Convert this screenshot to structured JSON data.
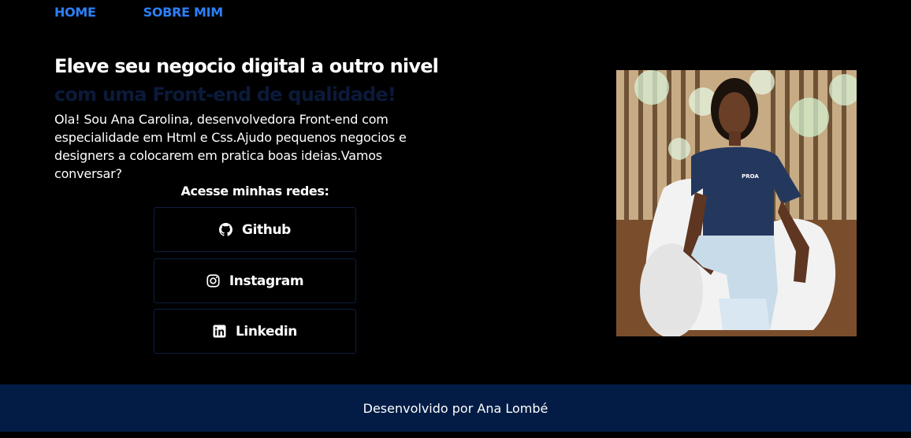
{
  "nav": {
    "home_label": "HOME",
    "about_label": "SOBRE MIM"
  },
  "hero": {
    "title": "Eleve seu negocio digital a outro nivel",
    "subtitle": "com uma Front-end de qualidade!",
    "intro": "Ola! Sou Ana Carolina, desenvolvedora Front-end com especialidade em Html e Css.Ajudo pequenos negocios e designers a colocarem em pratica boas ideias.Vamos conversar?"
  },
  "socials": {
    "heading": "Acesse minhas redes:",
    "items": [
      {
        "label": "Github",
        "icon": "github-icon"
      },
      {
        "label": "Instagram",
        "icon": "instagram-icon"
      },
      {
        "label": "Linkedin",
        "icon": "linkedin-icon"
      }
    ]
  },
  "profile_photo": {
    "shirt_text": "PROA"
  },
  "footer": {
    "credit": "Desenvolvido por Ana Lombé"
  },
  "colors": {
    "background": "#000000",
    "nav_link": "#2d7ff9",
    "subtitle": "#0b1a3a",
    "footer_bg": "#021c45",
    "button_border": "#0d1f3f"
  }
}
